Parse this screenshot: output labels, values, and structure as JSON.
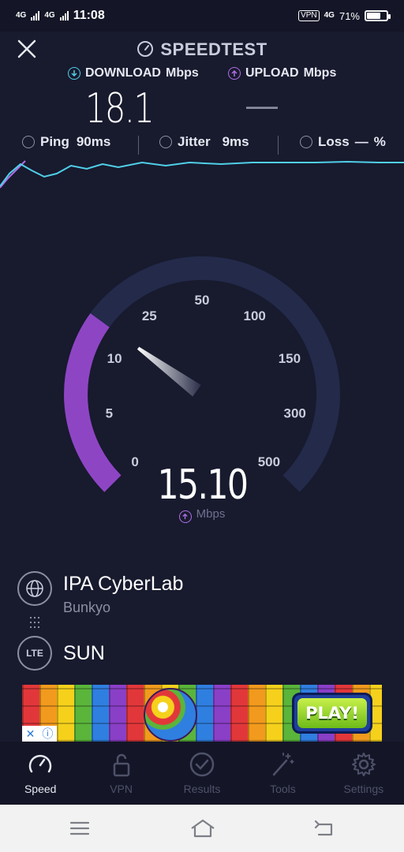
{
  "status_bar": {
    "network_1": "4G",
    "network_2": "4G",
    "time": "11:08",
    "vpn": "VPN",
    "network_3": "4G",
    "battery_text": "71%",
    "battery_level": 0.71
  },
  "header": {
    "title": "SPEEDTEST"
  },
  "download": {
    "label": "DOWNLOAD",
    "unit": "Mbps",
    "value": "18.1"
  },
  "upload": {
    "label": "UPLOAD",
    "unit": "Mbps",
    "value": "—"
  },
  "stats": {
    "ping_label": "Ping",
    "ping_value": "90ms",
    "jitter_label": "Jitter",
    "jitter_value": "9ms",
    "loss_label": "Loss",
    "loss_value": "—",
    "loss_unit": "%"
  },
  "gauge": {
    "ticks": [
      "0",
      "5",
      "10",
      "25",
      "50",
      "100",
      "150",
      "300",
      "500"
    ],
    "value": "15.10",
    "unit": "Mbps",
    "fill_fraction": 0.3
  },
  "server": {
    "name": "IPA CyberLab",
    "location": "Bunkyo"
  },
  "isp": {
    "badge": "LTE",
    "name": "SUN"
  },
  "ad": {
    "cta": "PLAY!",
    "close": "✕",
    "info": "ⓘ"
  },
  "tabs": [
    {
      "label": "Speed",
      "active": true
    },
    {
      "label": "VPN",
      "active": false
    },
    {
      "label": "Results",
      "active": false
    },
    {
      "label": "Tools",
      "active": false
    },
    {
      "label": "Settings",
      "active": false
    }
  ],
  "colors": {
    "background": "#181a2e",
    "accent_download": "#4fd0e8",
    "accent_upload": "#b06ee6",
    "gauge_track": "#232a4a"
  }
}
